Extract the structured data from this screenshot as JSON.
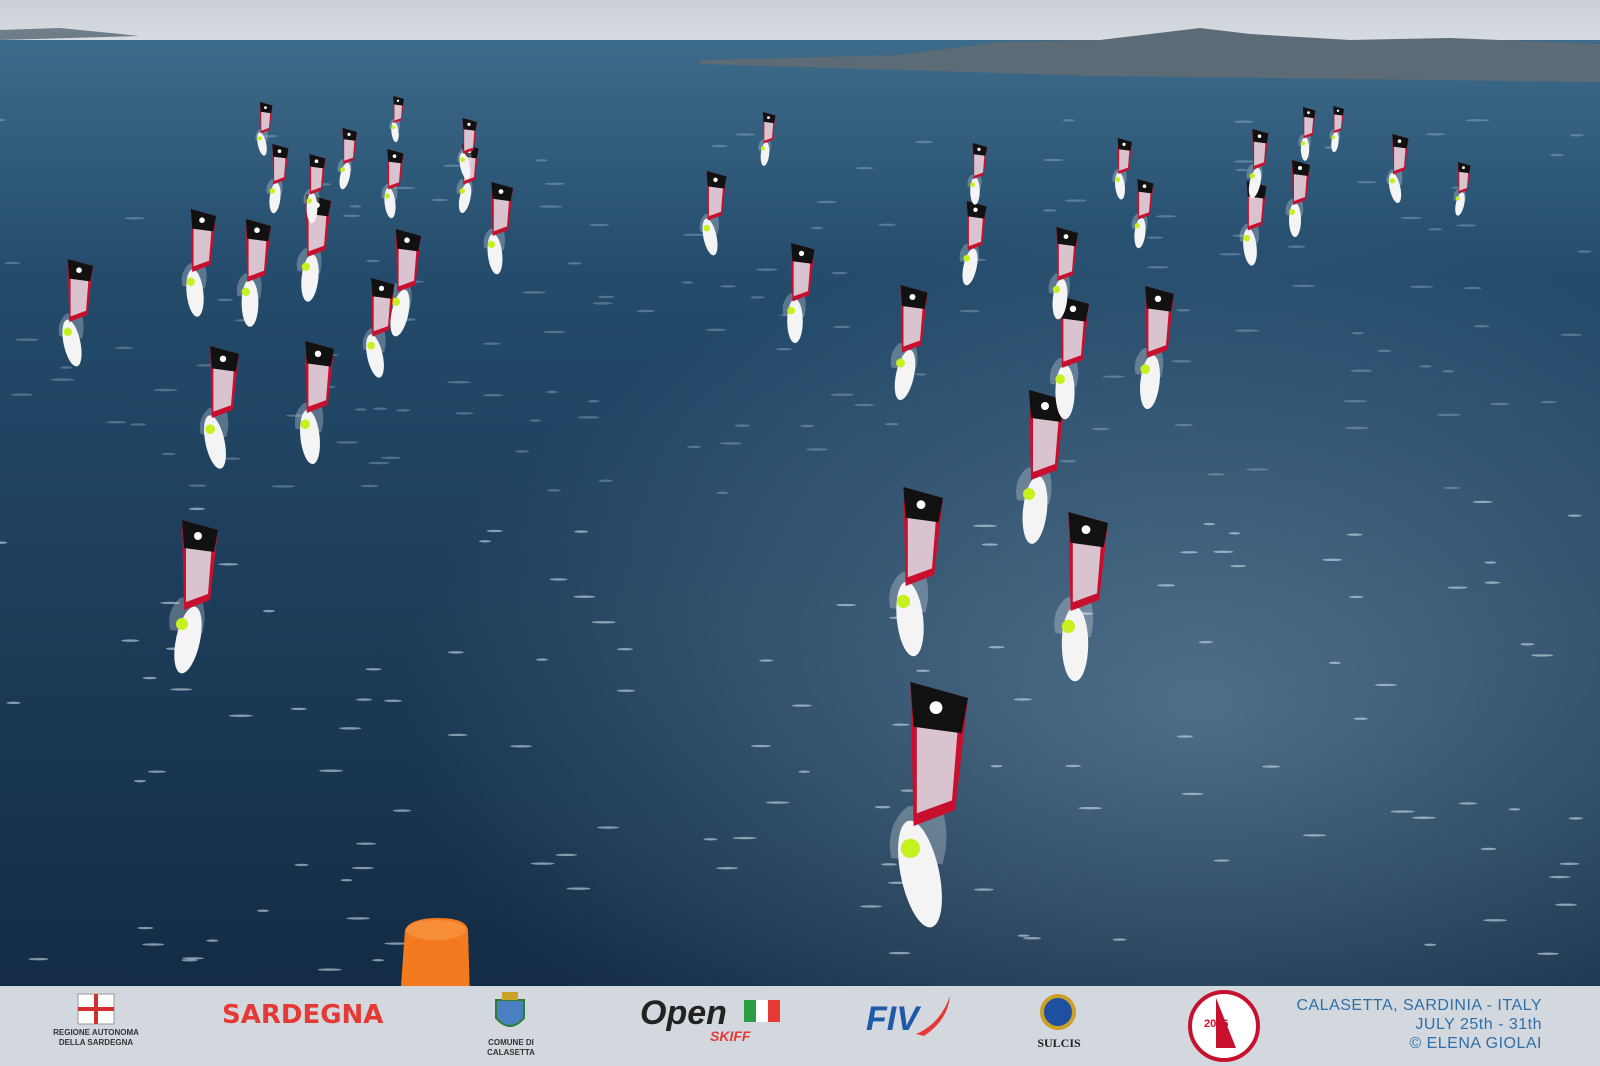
{
  "photo": {
    "subject": "aerial-windsurf-regatta",
    "colors": {
      "sea": "#1d3c5a",
      "sail_red": "#c8102e",
      "sail_black": "#111111",
      "lycra": "#c6f01e",
      "buoy": "#f47a1f"
    }
  },
  "footer": {
    "region_logo_text": "REGIONE AUTONOMA DELLA SARDEGNA",
    "sardegna_logo_text": "SARDEGNA",
    "comune_logo_text": "COMUNE DI CALASETTA",
    "open_logo_text": "Open",
    "skiff_logo_text": "SKIFF",
    "fiv_logo_text": "FIV",
    "sulcis_logo_text": "SULCIS",
    "event_logo_year": "2026",
    "location": "CALASETTA, SARDINIA - ITALY",
    "dates": "JULY  25th - 31th",
    "credit": "© ELENA GIOLAI"
  }
}
